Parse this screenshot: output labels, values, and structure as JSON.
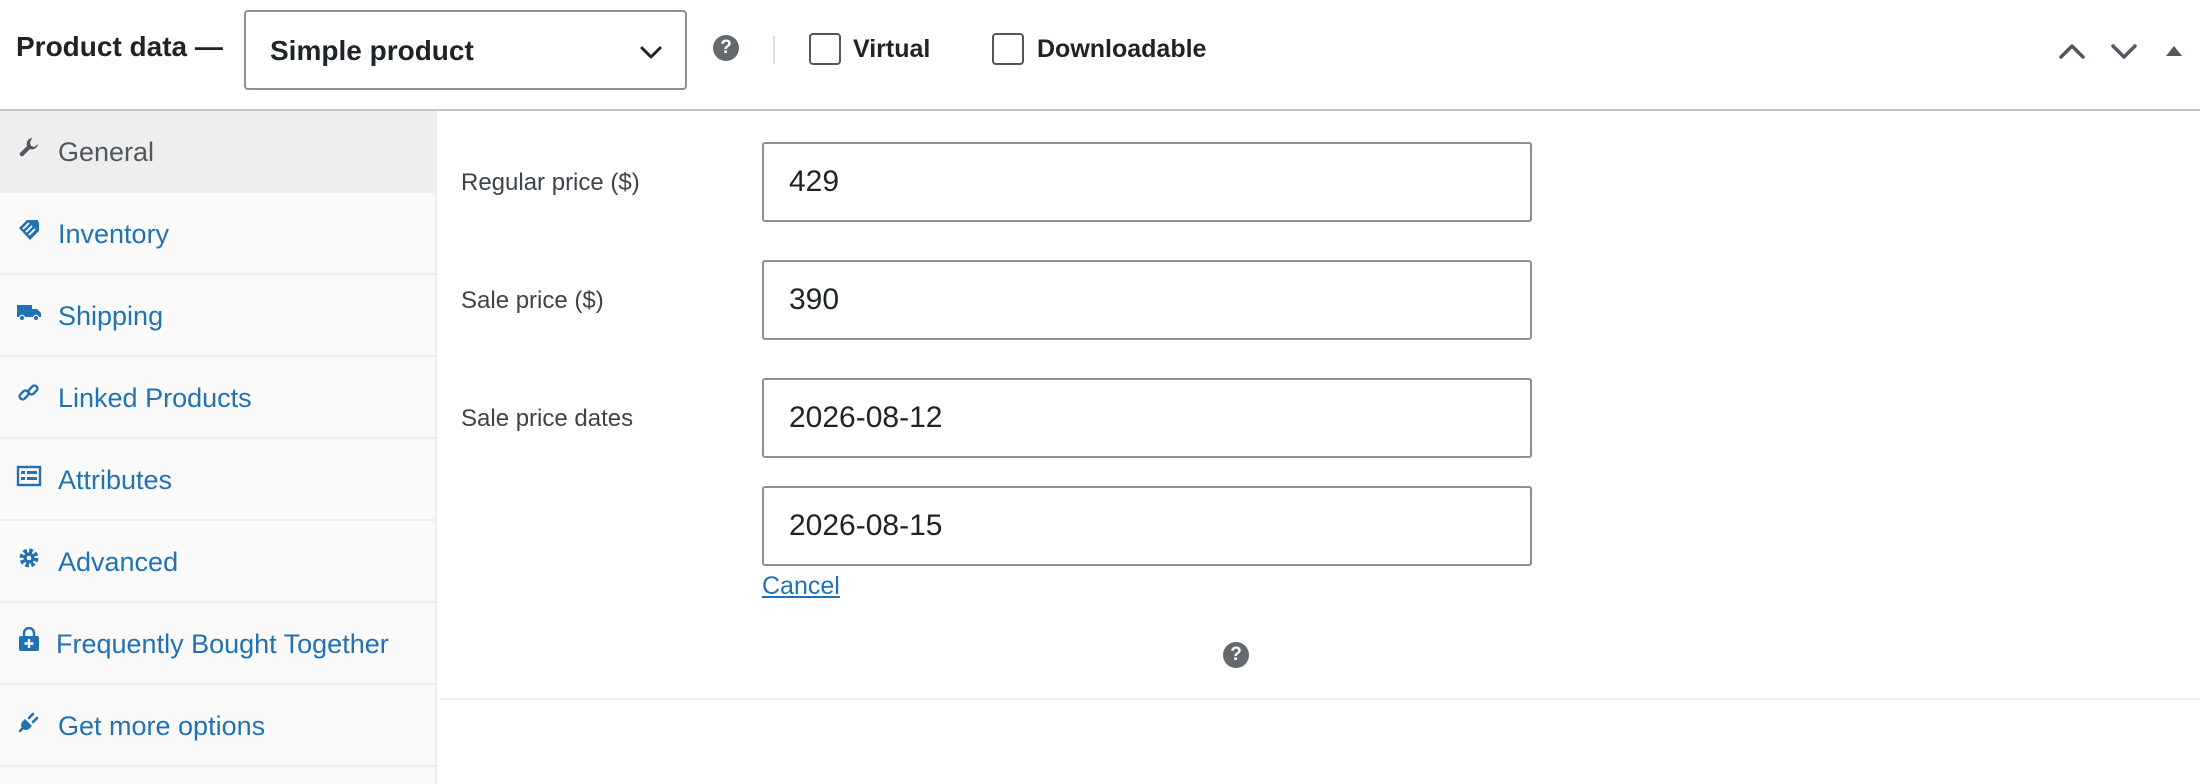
{
  "header": {
    "title": "Product data —",
    "product_type": {
      "selected": "Simple product",
      "icon": "chevron-down-icon"
    },
    "help_icon": "?",
    "virtual_label": "Virtual",
    "virtual_checked": false,
    "downloadable_label": "Downloadable",
    "downloadable_checked": false,
    "controls": [
      "move-up-icon",
      "move-down-icon",
      "toggle-panel-icon"
    ]
  },
  "sidebar": {
    "items": [
      {
        "label": "General",
        "icon": "wrench-icon",
        "active": true
      },
      {
        "label": "Inventory",
        "icon": "tag-icon",
        "active": false
      },
      {
        "label": "Shipping",
        "icon": "truck-icon",
        "active": false
      },
      {
        "label": "Linked Products",
        "icon": "link-icon",
        "active": false
      },
      {
        "label": "Attributes",
        "icon": "list-card-icon",
        "active": false
      },
      {
        "label": "Advanced",
        "icon": "gear-icon",
        "active": false
      },
      {
        "label": "Frequently Bought Together",
        "icon": "shopping-bag-plus-icon",
        "active": false
      },
      {
        "label": "Get more options",
        "icon": "plugin-icon",
        "active": false
      }
    ]
  },
  "general": {
    "regular_price": {
      "label": "Regular price ($)",
      "value": "429"
    },
    "sale_price": {
      "label": "Sale price ($)",
      "value": "390"
    },
    "sale_dates": {
      "label": "Sale price dates",
      "from": "2026-08-12",
      "to": "2026-08-15",
      "cancel_label": "Cancel"
    },
    "help_icon": "?"
  },
  "colors": {
    "link": "#2271b1",
    "text": "#1d2327",
    "muted": "#50575e",
    "border": "#8c8f94",
    "active_tab_bg": "#eeeeee",
    "sidebar_bg": "#fafafa"
  }
}
